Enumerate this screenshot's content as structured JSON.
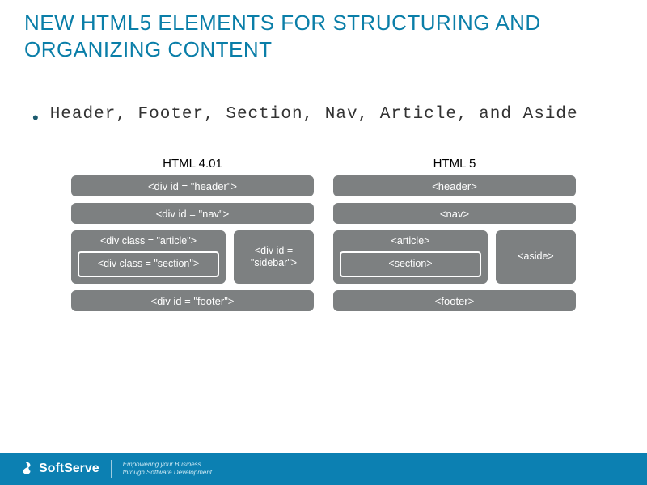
{
  "title": {
    "line1": "New HTML5 Elements for Structuring and",
    "line2": "Organizing Content"
  },
  "bullet": "Header, Footer, Section, Nav, Article, and Aside",
  "left": {
    "heading": "HTML 4.01",
    "header": "<div id = \"header\">",
    "nav": "<div id = \"nav\">",
    "article": "<div class = \"article\">",
    "section": "<div class = \"section\">",
    "sidebar": "<div id = \"sidebar\">",
    "footer": "<div id = \"footer\">"
  },
  "right": {
    "heading": "HTML 5",
    "header": "<header>",
    "nav": "<nav>",
    "article": "<article>",
    "section": "<section>",
    "aside": "<aside>",
    "footer": "<footer>"
  },
  "footer": {
    "brand": "SoftServe",
    "tagline1": "Empowering your Business",
    "tagline2": "through Software Development"
  }
}
